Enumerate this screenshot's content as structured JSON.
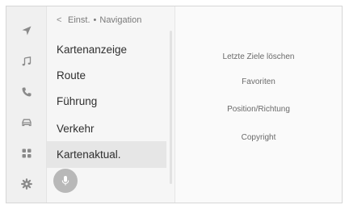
{
  "breadcrumb": {
    "back_icon": "chevron-left-icon",
    "parent": "Einst.",
    "separator": "•",
    "current": "Navigation"
  },
  "rail": {
    "items": [
      {
        "name": "navigation-arrow-icon",
        "selected": false
      },
      {
        "name": "music-note-icon",
        "selected": false
      },
      {
        "name": "phone-icon",
        "selected": false
      },
      {
        "name": "car-icon",
        "selected": false
      },
      {
        "name": "apps-grid-icon",
        "selected": false
      },
      {
        "name": "gear-icon",
        "selected": true
      }
    ]
  },
  "menu": {
    "items": [
      {
        "label": "Kartenanzeige",
        "selected": false
      },
      {
        "label": "Route",
        "selected": false
      },
      {
        "label": "Führung",
        "selected": false
      },
      {
        "label": "Verkehr",
        "selected": false
      },
      {
        "label": "Kartenaktual.",
        "selected": true
      }
    ]
  },
  "voice_button": {
    "icon": "microphone-icon"
  },
  "actions": [
    {
      "label": "Letzte Ziele löschen"
    },
    {
      "label": "Favoriten"
    },
    {
      "label": "Position/Richtung"
    },
    {
      "label": "Copyright"
    }
  ],
  "colors": {
    "background": "#fafafa",
    "rail": "#f0f0f0",
    "menu": "#f6f6f6",
    "selected": "#e6e6e6",
    "icon": "#8a8a8a",
    "voice_button": "#b8b8b8"
  }
}
